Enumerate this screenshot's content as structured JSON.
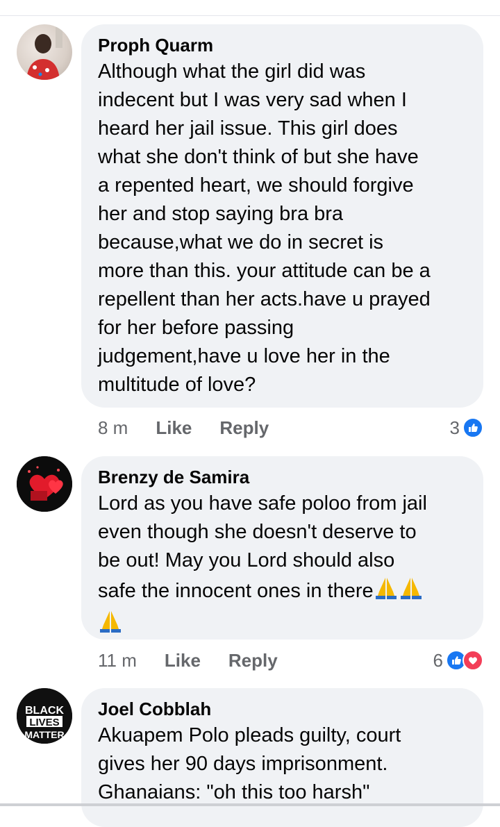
{
  "comments": [
    {
      "author": "Proph Quarm",
      "text": "Although what the girl did was\nindecent but I was very sad when I\nheard her jail issue. This girl does\nwhat she don't think of but she have\na repented heart, we should forgive\nher and stop saying bra bra\nbecause,what we do in secret is\nmore than this. your attitude can be a\nrepellent than her acts.have u prayed\nfor her before passing\njudgement,have u love her in the\nmultitude of love?",
      "time": "8 m",
      "like_label": "Like",
      "reply_label": "Reply",
      "reaction_count": "3",
      "reactions": [
        "like-icon"
      ]
    },
    {
      "author": "Brenzy de Samira",
      "text": "Lord as you have safe poloo from jail\neven though she doesn't deserve to\nbe out! May you Lord should also\nsafe the innocent ones in there",
      "time": "11 m",
      "like_label": "Like",
      "reply_label": "Reply",
      "reaction_count": "6",
      "reactions": [
        "like-icon",
        "love-icon"
      ]
    },
    {
      "author": "Joel Cobblah",
      "text": "Akuapem Polo pleads guilty, court\ngives her 90 days imprisonment.\nGhanaians: \"oh this too harsh\"",
      "avatar_text": [
        "BLACK",
        "LIVES",
        "MATTER"
      ]
    }
  ],
  "colors": {
    "bubble": "#f0f2f5",
    "meta": "#65676b",
    "like": "#1877f2",
    "love": "#f33e58"
  }
}
